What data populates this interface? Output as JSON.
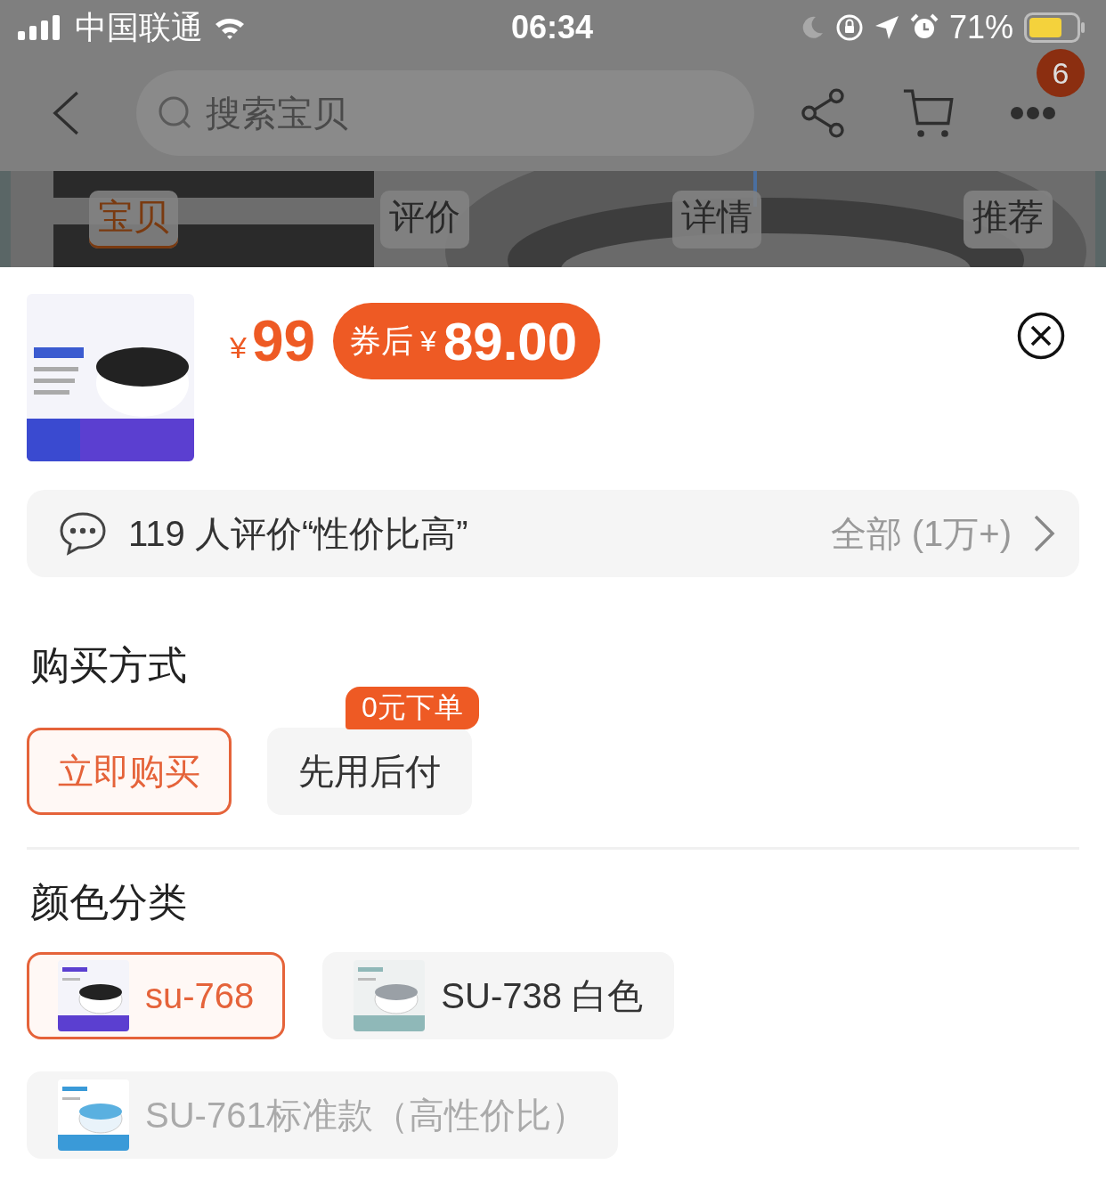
{
  "status_bar": {
    "carrier": "中国联通",
    "time": "06:34",
    "battery": "71%"
  },
  "nav": {
    "search_placeholder": "搜索宝贝",
    "badge": "6"
  },
  "tabs": [
    {
      "label": "宝贝",
      "selected": true
    },
    {
      "label": "评价",
      "selected": false
    },
    {
      "label": "详情",
      "selected": false
    },
    {
      "label": "推荐",
      "selected": false
    }
  ],
  "product": {
    "currency": "¥",
    "price": "99",
    "coupon": {
      "label": "券后",
      "currency": "¥",
      "price": "89.00"
    }
  },
  "review_bar": {
    "summary": "119 人评价“性价比高”",
    "all_link": "全部 (1万+)"
  },
  "purchase": {
    "title": "购买方式",
    "options": [
      {
        "label": "立即购买",
        "selected": true
      },
      {
        "label": "先用后付",
        "selected": false,
        "badge": "0元下单"
      }
    ]
  },
  "colors": {
    "title": "颜色分类",
    "options": [
      {
        "label": "su-768",
        "selected": true,
        "disabled": false
      },
      {
        "label": "SU-738 白色",
        "selected": false,
        "disabled": false
      },
      {
        "label": "SU-761标准款（高性价比）",
        "selected": false,
        "disabled": true
      }
    ]
  }
}
